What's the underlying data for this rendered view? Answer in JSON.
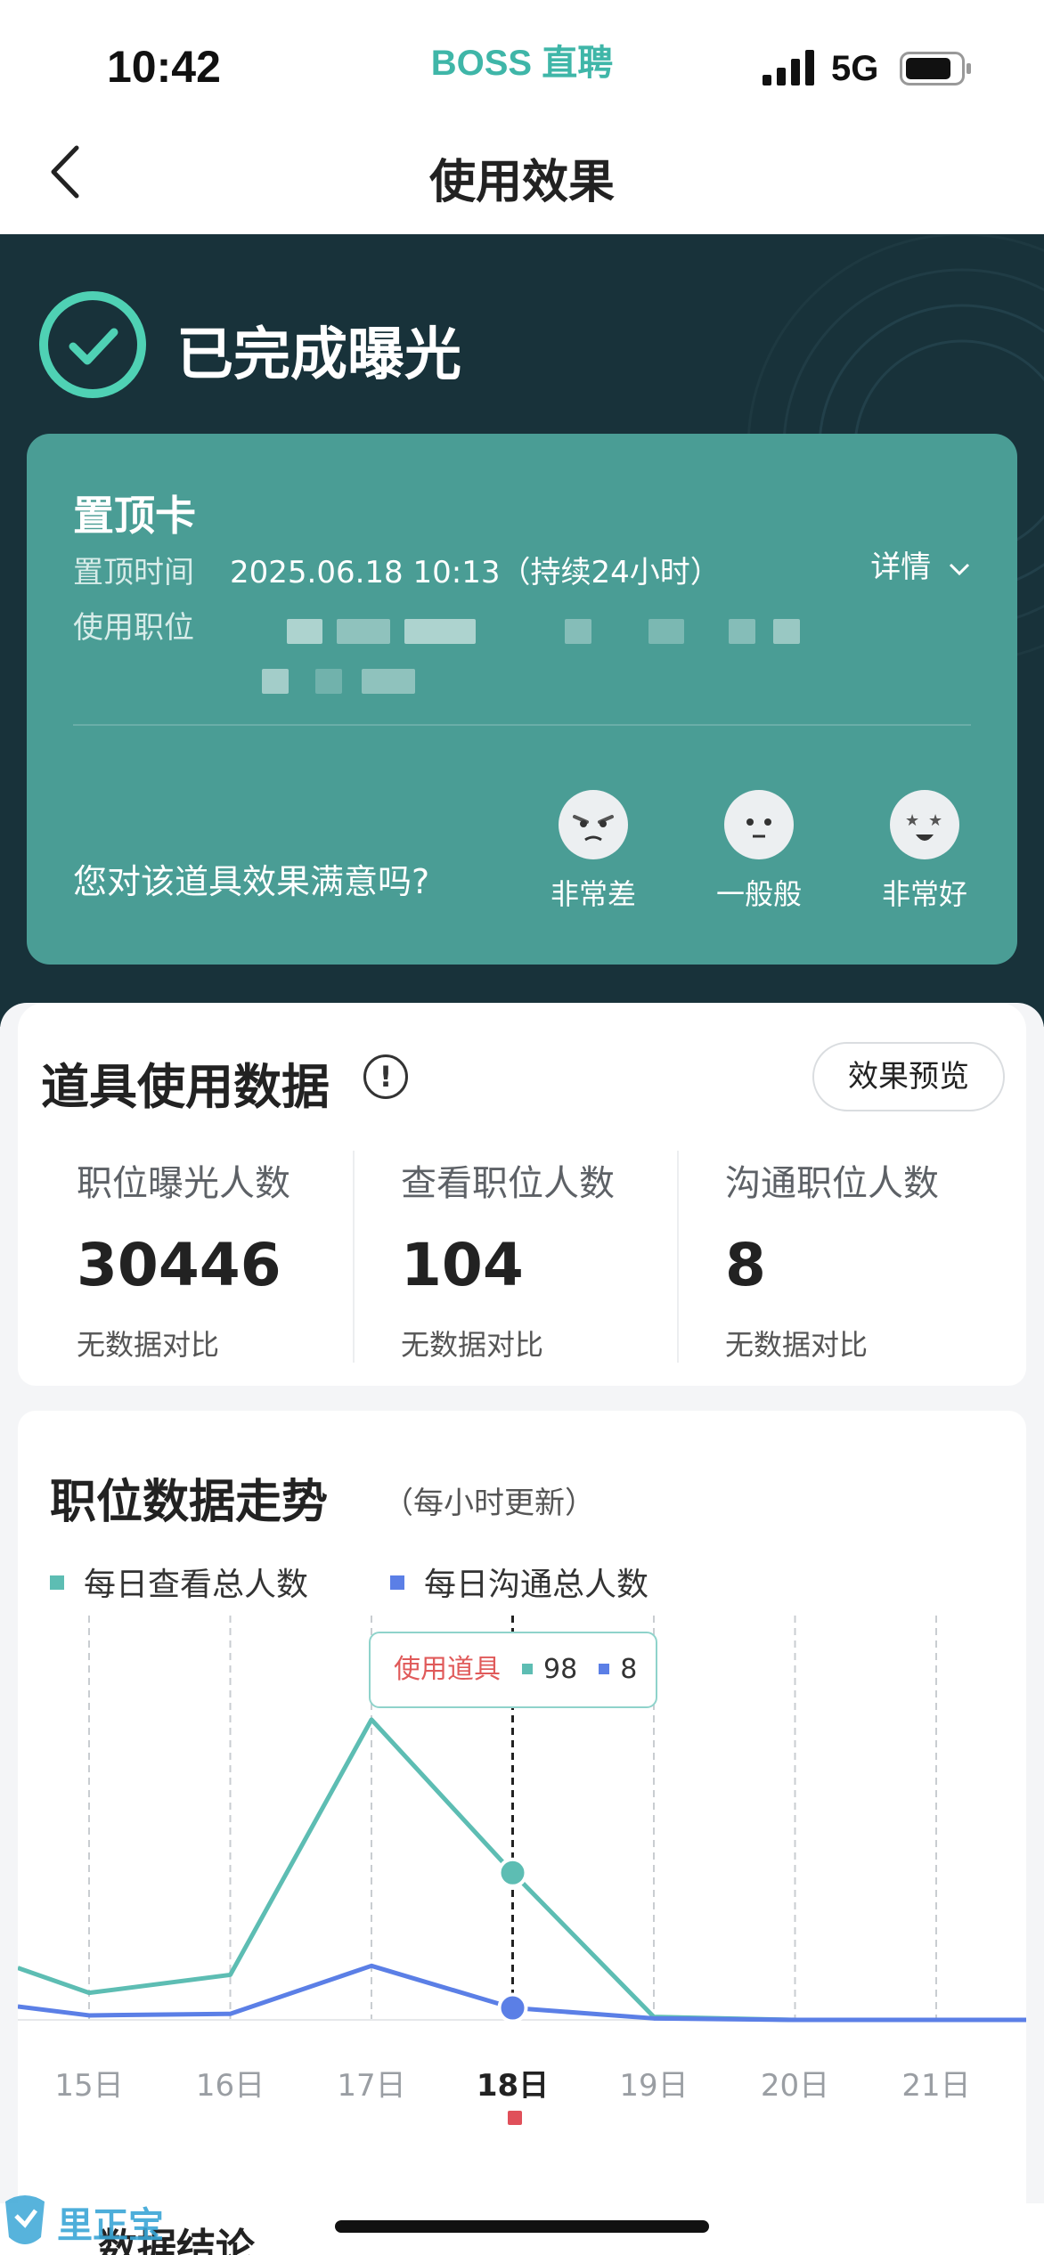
{
  "status_bar": {
    "time": "10:42",
    "app_brand": "BOSS 直聘",
    "network": "5G"
  },
  "nav": {
    "title": "使用效果"
  },
  "hero": {
    "status": "已完成曝光",
    "card": {
      "title": "置顶卡",
      "time_label": "置顶时间",
      "time_value": "2025.06.18 10:13（持续24小时）",
      "position_label": "使用职位",
      "detail_label": "详情",
      "question": "您对该道具效果满意吗?",
      "ratings": [
        {
          "label": "非常差",
          "icon": "angry-face-icon"
        },
        {
          "label": "一般般",
          "icon": "neutral-face-icon"
        },
        {
          "label": "非常好",
          "icon": "star-eyes-face-icon"
        }
      ]
    }
  },
  "stats": {
    "title": "道具使用数据",
    "preview_button": "效果预览",
    "items": [
      {
        "label": "职位曝光人数",
        "value": "30446",
        "note": "无数据对比"
      },
      {
        "label": "查看职位人数",
        "value": "104",
        "note": "无数据对比"
      },
      {
        "label": "沟通职位人数",
        "value": "8",
        "note": "无数据对比"
      }
    ]
  },
  "trend": {
    "title": "职位数据走势",
    "subtitle": "（每小时更新）",
    "tooltip": {
      "label": "使用道具",
      "view_value": "98",
      "chat_value": "8"
    },
    "footer_title": "数据结论"
  },
  "watermark": "里正宝",
  "colors": {
    "teal": "#5dbdb3",
    "blue": "#5b7fe6",
    "hero_bg": "#18323a",
    "card_bg": "#4a9d95",
    "marker": "#e0505a"
  },
  "chart_data": {
    "type": "line",
    "categories": [
      "15日",
      "16日",
      "17日",
      "18日",
      "19日",
      "20日",
      "21日"
    ],
    "active_category": "18日",
    "series": [
      {
        "name": "每日查看总人数",
        "color": "#5dbdb3",
        "values": [
          18,
          30,
          200,
          98,
          2,
          0,
          0
        ]
      },
      {
        "name": "每日沟通总人数",
        "color": "#5b7fe6",
        "values": [
          3,
          4,
          36,
          8,
          1,
          0,
          0
        ]
      }
    ],
    "ylim": [
      0,
      210
    ],
    "grid": "vertical dashed",
    "legend": "top-left"
  }
}
